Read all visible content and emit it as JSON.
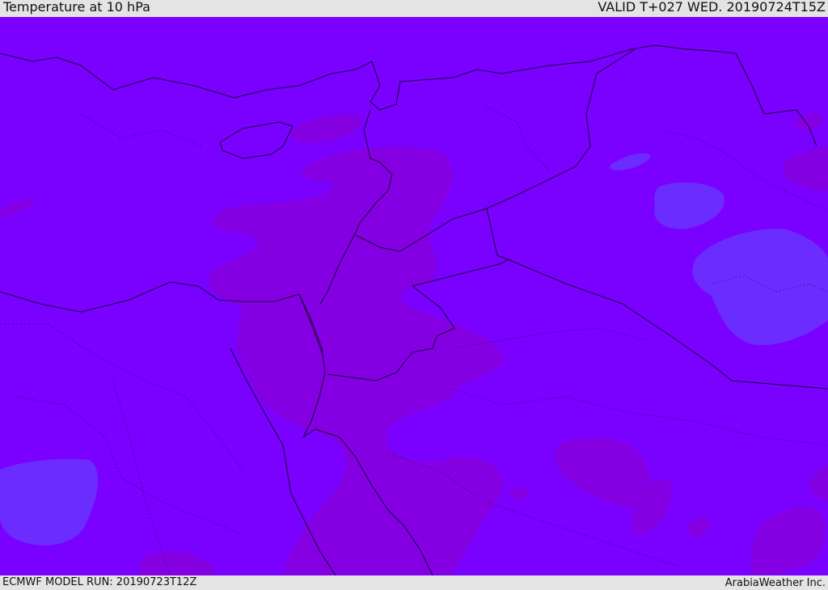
{
  "header": {
    "title": "Temperature at 10 hPa",
    "valid_time": "VALID T+027 WED. 20190724T15Z"
  },
  "footer": {
    "model_run": "ECMWF MODEL RUN: 20190723T12Z",
    "credit": "ArabiaWeather Inc."
  },
  "map": {
    "field": "temperature",
    "level": "10 hPa",
    "colors": {
      "base": "#7a00ff",
      "warm_patch": "#8a00e0",
      "cool_patch": "#6d2cff",
      "border_line": "#1a0033"
    }
  }
}
